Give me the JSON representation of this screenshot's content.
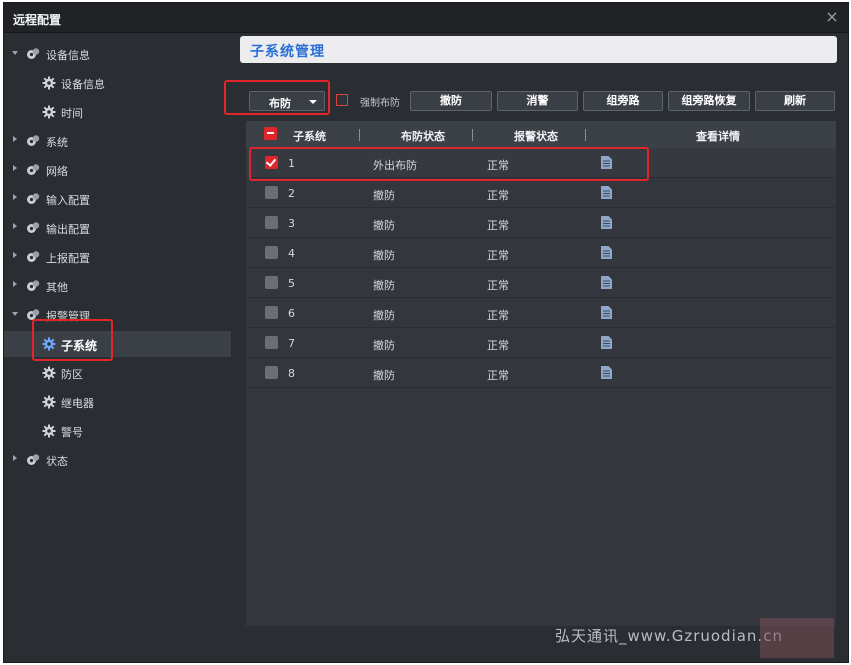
{
  "window": {
    "title": "远程配置",
    "close_icon": "close-icon"
  },
  "sidebar": {
    "items": [
      {
        "label": "设备信息",
        "level": 1,
        "expanded": true
      },
      {
        "label": "设备信息",
        "level": 2
      },
      {
        "label": "时间",
        "level": 2
      },
      {
        "label": "系统",
        "level": 1,
        "expanded": false
      },
      {
        "label": "网络",
        "level": 1,
        "expanded": false
      },
      {
        "label": "输入配置",
        "level": 1,
        "expanded": false
      },
      {
        "label": "输出配置",
        "level": 1,
        "expanded": false
      },
      {
        "label": "上报配置",
        "level": 1,
        "expanded": false
      },
      {
        "label": "其他",
        "level": 1,
        "expanded": false
      },
      {
        "label": "报警管理",
        "level": 1,
        "expanded": true
      },
      {
        "label": "子系统",
        "level": 2,
        "selected": true
      },
      {
        "label": "防区",
        "level": 2
      },
      {
        "label": "继电器",
        "level": 2
      },
      {
        "label": "警号",
        "level": 2
      },
      {
        "label": "状态",
        "level": 1,
        "expanded": false
      }
    ]
  },
  "panel": {
    "title": "子系统管理"
  },
  "toolbar": {
    "arm_select_value": "布防",
    "force_arm_label": "强制布防",
    "force_arm_checked": false,
    "disarm_label": "撤防",
    "clear_alarm_label": "消警",
    "group_bypass_label": "组旁路",
    "group_bypass_restore_label": "组旁路恢复",
    "refresh_label": "刷新"
  },
  "table": {
    "columns": [
      "子系统",
      "布防状态",
      "报警状态",
      "查看详情"
    ],
    "rows": [
      {
        "id": "1",
        "arm_status": "外出布防",
        "alarm_status": "正常",
        "checked": true
      },
      {
        "id": "2",
        "arm_status": "撤防",
        "alarm_status": "正常",
        "checked": false
      },
      {
        "id": "3",
        "arm_status": "撤防",
        "alarm_status": "正常",
        "checked": false
      },
      {
        "id": "4",
        "arm_status": "撤防",
        "alarm_status": "正常",
        "checked": false
      },
      {
        "id": "5",
        "arm_status": "撤防",
        "alarm_status": "正常",
        "checked": false
      },
      {
        "id": "6",
        "arm_status": "撤防",
        "alarm_status": "正常",
        "checked": false
      },
      {
        "id": "7",
        "arm_status": "撤防",
        "alarm_status": "正常",
        "checked": false
      },
      {
        "id": "8",
        "arm_status": "撤防",
        "alarm_status": "正常",
        "checked": false
      }
    ]
  },
  "watermark": "弘天通讯_www.Gzruodian.cn",
  "colors": {
    "accent_red": "#e0262b",
    "title_blue": "#2b6fd6",
    "background": "#2a2d32"
  }
}
